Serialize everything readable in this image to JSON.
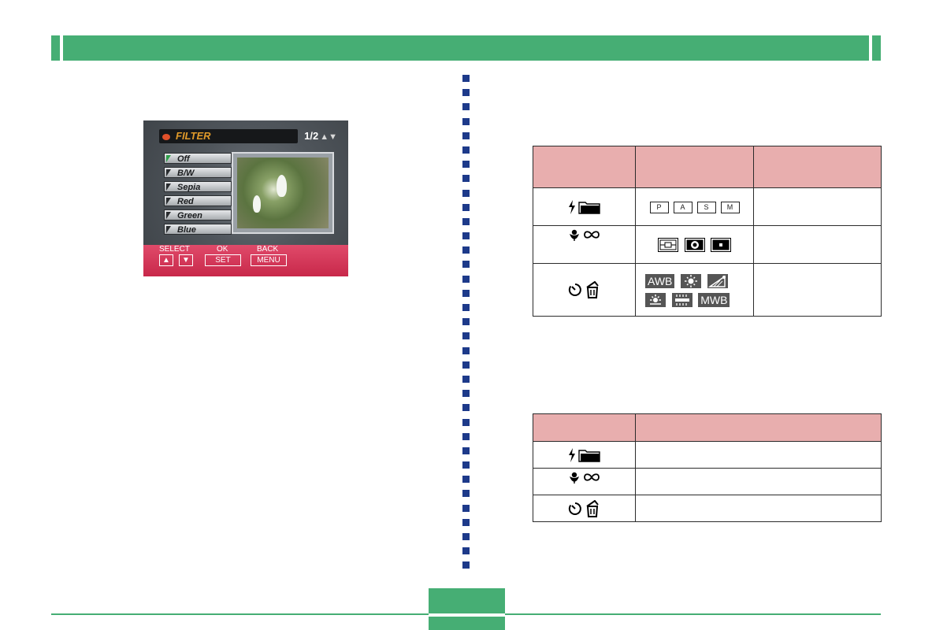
{
  "camera_screen": {
    "title": "FILTER",
    "page": "1/2",
    "page_arrows": "▲▼",
    "options": [
      "Off",
      "B/W",
      "Sepia",
      "Red",
      "Green",
      "Blue"
    ],
    "selected_option": "Off",
    "controls": {
      "select_label": "SELECT",
      "select_up": "▲",
      "select_down": "▼",
      "ok_label": "OK",
      "ok_key": "SET",
      "back_label": "BACK",
      "back_key": "MENU"
    }
  },
  "table1": {
    "mode_boxes": [
      "P",
      "A",
      "S",
      "M"
    ],
    "wb_row1": [
      "AWB"
    ],
    "wb_row2": [
      "MWB"
    ]
  },
  "colors": {
    "header_green": "#46ae74",
    "table_header_pink": "#e8aeae",
    "dot_blue": "#1d3a8a",
    "lcd_bar_red": "#d0304f"
  },
  "icons": {
    "flash": "flash-icon",
    "folder": "folder-icon",
    "macro": "macro-icon",
    "infinity": "infinity-icon",
    "self_timer": "self-timer-icon",
    "delete": "delete-icon"
  }
}
